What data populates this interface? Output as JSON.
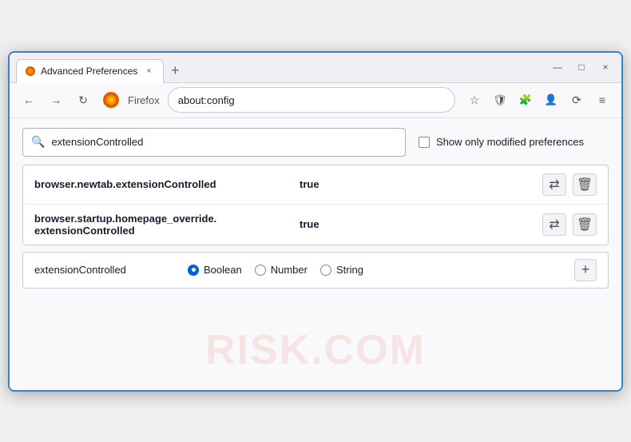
{
  "window": {
    "title": "Advanced Preferences",
    "close_label": "×",
    "minimize_label": "—",
    "maximize_label": "□",
    "new_tab_label": "+"
  },
  "browser_name": "Firefox",
  "address_bar": {
    "url": "about:config"
  },
  "search": {
    "placeholder": "extensionControlled",
    "value": "extensionControlled",
    "show_modified_label": "Show only modified preferences"
  },
  "preferences": [
    {
      "name": "browser.newtab.extensionControlled",
      "value": "true",
      "multiline": false
    },
    {
      "name_line1": "browser.startup.homepage_override.",
      "name_line2": "extensionControlled",
      "value": "true",
      "multiline": true
    }
  ],
  "new_pref": {
    "name": "extensionControlled",
    "type_options": [
      "Boolean",
      "Number",
      "String"
    ],
    "selected_type": "Boolean"
  },
  "watermark": "RISK.COM",
  "radio_labels": {
    "boolean": "Boolean",
    "number": "Number",
    "string": "String"
  },
  "icons": {
    "search": "🔍",
    "back": "←",
    "forward": "→",
    "reload": "↻",
    "star": "☆",
    "shield": "🛡",
    "puzzle": "🧩",
    "profile": "👤",
    "menu": "≡",
    "reset": "⇄",
    "trash": "🗑",
    "close_tab": "×",
    "add": "+"
  }
}
